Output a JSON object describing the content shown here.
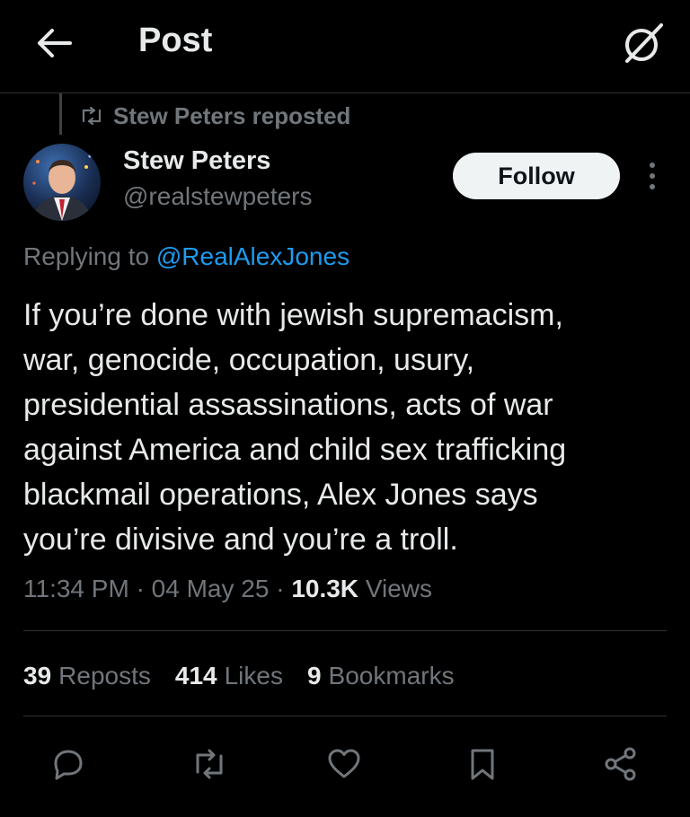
{
  "header": {
    "title": "Post",
    "back_icon": "arrow-left-icon",
    "grok_icon": "grok-icon"
  },
  "repost": {
    "label": "Stew Peters reposted",
    "icon": "repost-icon"
  },
  "author": {
    "name": "Stew Peters",
    "handle": "@realstewpeters",
    "follow_label": "Follow"
  },
  "reply": {
    "prefix": "Replying to",
    "mention": "@RealAlexJones"
  },
  "post": {
    "lines": [
      "If you’re done with jewish supremacism,",
      "war, genocide, occupation, usury,",
      "presidential assassinations, acts of war",
      "against America and child sex trafficking",
      "blackmail operations, Alex Jones says",
      "you’re divisive and you’re a troll."
    ]
  },
  "meta": {
    "time": "11:34 PM",
    "separator": "·",
    "date": "04 May 25",
    "views_count": "10.3K",
    "views_label": "Views"
  },
  "stats": {
    "reposts_count": "39",
    "reposts_label": "Reposts",
    "likes_count": "414",
    "likes_label": "Likes",
    "bookmarks_count": "9",
    "bookmarks_label": "Bookmarks"
  },
  "actions": [
    "reply-icon",
    "repost-icon",
    "like-icon",
    "bookmark-icon",
    "share-icon"
  ],
  "colors": {
    "background": "#000000",
    "text": "#e7e9ea",
    "muted": "#71767b",
    "link": "#1d9bf0",
    "divider": "#2f3336",
    "follow_bg": "#eff3f4"
  }
}
